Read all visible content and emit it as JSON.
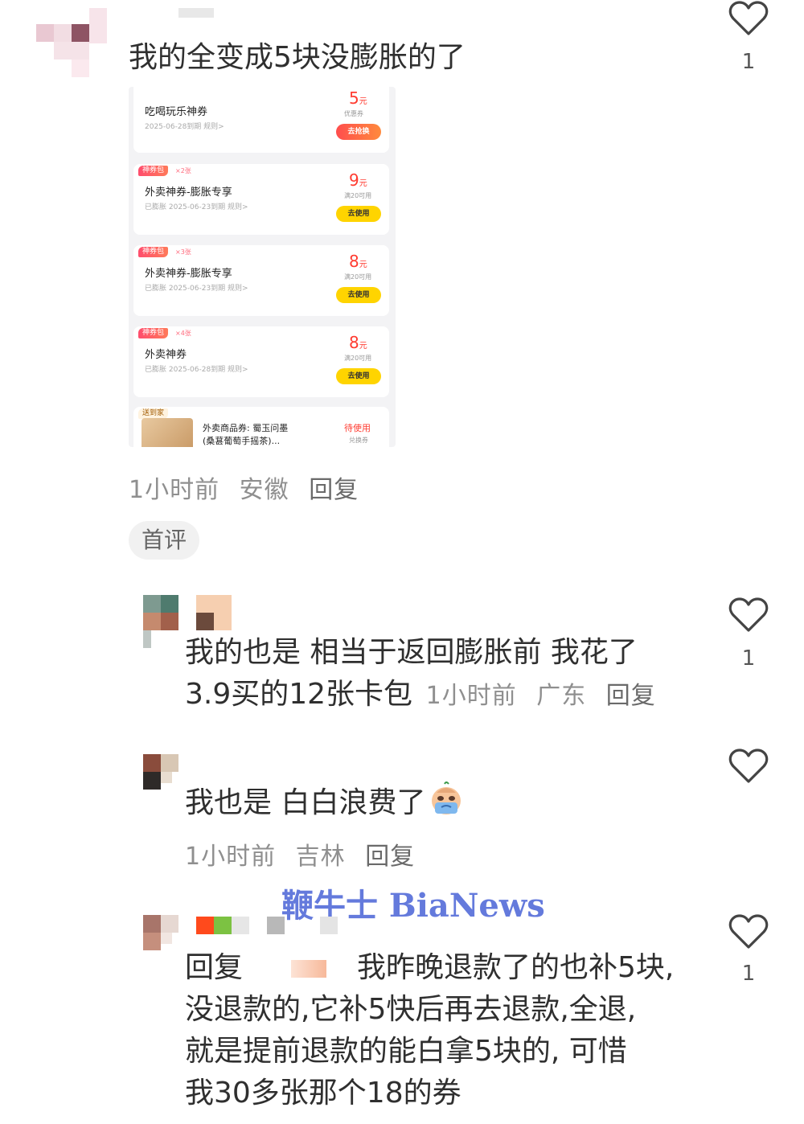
{
  "comments": [
    {
      "text": "我的全变成5块没膨胀的了",
      "likes": "1",
      "time": "1小时前",
      "location": "安徽",
      "reply": "回复",
      "badge": "首评"
    },
    {
      "line1": "我的也是 相当于返回膨胀前 我花了",
      "line2": "3.9买的12张卡包",
      "likes": "1",
      "time": "1小时前",
      "location": "广东",
      "reply": "回复"
    },
    {
      "text": "我也是 白白浪费了",
      "emoji": "crying-face",
      "time": "1小时前",
      "location": "吉林",
      "reply": "回复"
    },
    {
      "reply_prefix": "回复",
      "line1": "我昨晚退款了的也补5块,",
      "line2": "没退款的,它补5快后再去退款,全退,",
      "line3": "就是提前退款的能白拿5块的, 可惜",
      "line4": "我30多张那个18的券",
      "likes": "1"
    }
  ],
  "coupons": [
    {
      "title": "吃喝玩乐神券",
      "sub": "2025-06-28到期 规则>",
      "amount": "5",
      "unit": "元",
      "cond": "优惠券",
      "button": "去抢换",
      "tag": "",
      "tag2": ""
    },
    {
      "title": "外卖神券-膨胀专享",
      "sub": "已膨胀 2025-06-23到期 规则>",
      "amount": "9",
      "unit": "元",
      "cond": "满20可用",
      "button": "去使用",
      "tag": "神券包",
      "tag2": "×2张"
    },
    {
      "title": "外卖神券-膨胀专享",
      "sub": "已膨胀 2025-06-23到期 规则>",
      "amount": "8",
      "unit": "元",
      "cond": "满20可用",
      "button": "去使用",
      "tag": "神券包",
      "tag2": "×3张"
    },
    {
      "title": "外卖神券",
      "sub": "已膨胀 2025-06-28到期 规则>",
      "amount": "8",
      "unit": "元",
      "cond": "满20可用",
      "button": "去使用",
      "tag": "神券包",
      "tag2": "×4张"
    }
  ],
  "product_coupon": {
    "tag": "送到家",
    "title": "外卖商品券: 蜀玉问墨",
    "sub": "(桑葚葡萄手摇茶)...",
    "status": "待使用",
    "kind": "兑换券"
  },
  "watermark": "鞭牛士 BiaNews",
  "colors": {
    "accent_red": "#ff3b30",
    "button_yellow": "#ffd400",
    "watermark": "#4a63d6"
  }
}
